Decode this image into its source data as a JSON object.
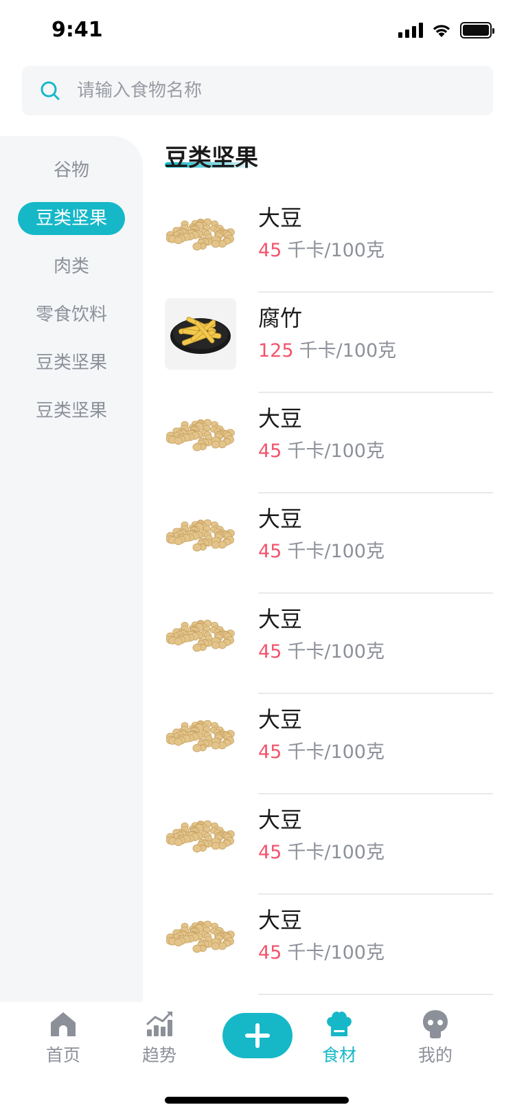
{
  "status_bar": {
    "time": "9:41"
  },
  "search": {
    "placeholder": "请输入食物名称"
  },
  "sidebar": {
    "items": [
      {
        "label": "谷物",
        "active": false
      },
      {
        "label": "豆类坚果",
        "active": true
      },
      {
        "label": "肉类",
        "active": false
      },
      {
        "label": "零食饮料",
        "active": false
      },
      {
        "label": "豆类坚果",
        "active": false
      },
      {
        "label": "豆类坚果",
        "active": false
      }
    ]
  },
  "section": {
    "title": "豆类坚果"
  },
  "foods": [
    {
      "name": "大豆",
      "calories": "45",
      "unit": "千卡/100克",
      "image": "soybean"
    },
    {
      "name": "腐竹",
      "calories": "125",
      "unit": "千卡/100克",
      "image": "yuba-plate"
    },
    {
      "name": "大豆",
      "calories": "45",
      "unit": "千卡/100克",
      "image": "soybean"
    },
    {
      "name": "大豆",
      "calories": "45",
      "unit": "千卡/100克",
      "image": "soybean"
    },
    {
      "name": "大豆",
      "calories": "45",
      "unit": "千卡/100克",
      "image": "soybean"
    },
    {
      "name": "大豆",
      "calories": "45",
      "unit": "千卡/100克",
      "image": "soybean"
    },
    {
      "name": "大豆",
      "calories": "45",
      "unit": "千卡/100克",
      "image": "soybean"
    },
    {
      "name": "大豆",
      "calories": "45",
      "unit": "千卡/100克",
      "image": "soybean"
    }
  ],
  "tabbar": {
    "home": {
      "label": "首页",
      "icon": "home-icon"
    },
    "trend": {
      "label": "趋势",
      "icon": "chart-icon"
    },
    "add": {
      "icon": "plus-icon"
    },
    "food": {
      "label": "食材",
      "icon": "chef-hat-icon",
      "active": true
    },
    "me": {
      "label": "我的",
      "icon": "user-icon"
    }
  },
  "colors": {
    "accent": "#16b8c8",
    "calorie": "#f2546c",
    "muted": "#8c9099",
    "sidebar_bg": "#f5f6f8"
  }
}
